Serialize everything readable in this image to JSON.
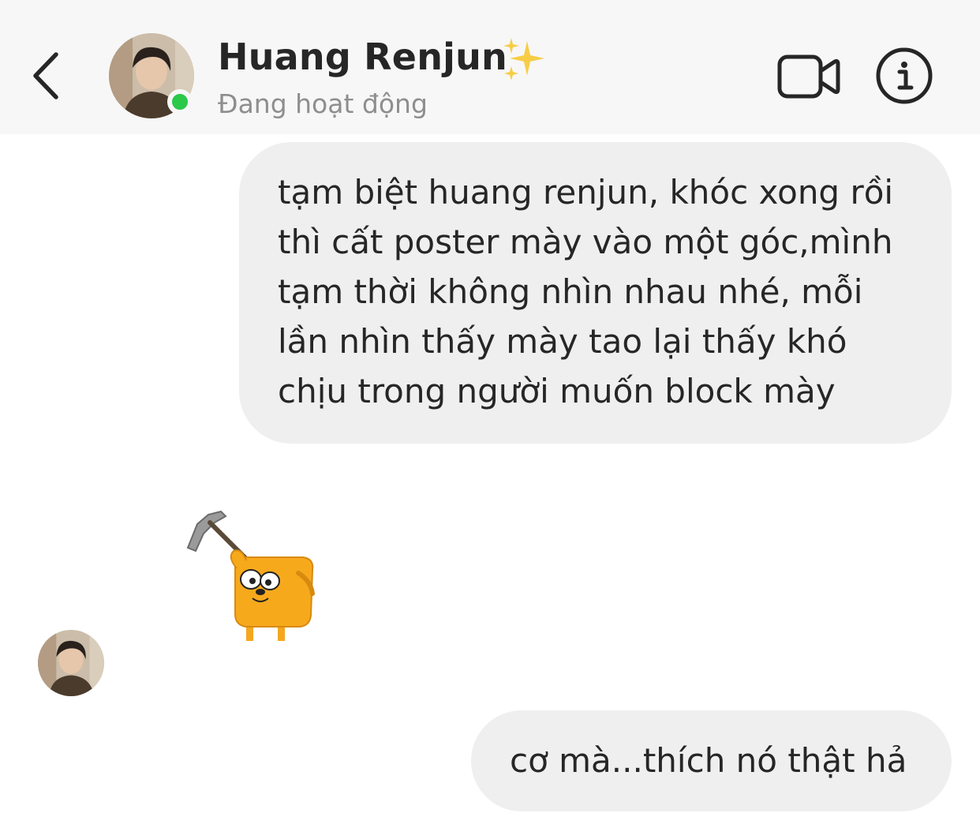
{
  "header": {
    "contact_name": "Huang Renjun",
    "status": "Đang hoạt động",
    "name_badge": "sparkles-emoji",
    "icons": {
      "back": "chevron-left-icon",
      "video_call": "video-camera-icon",
      "info": "info-circle-icon"
    },
    "online_color": "#2bc84a"
  },
  "messages": [
    {
      "sender": "me",
      "type": "text",
      "lines": [
        "tạm biệt huang renjun, khóc xong rồi",
        "thì cất poster mày vào một góc,mình",
        "tạm thời không nhìn nhau nhé, mỗi",
        "lần nhìn thấy mày tao lại thấy khó",
        "chịu trong người muốn block mày"
      ]
    },
    {
      "sender": "them",
      "type": "sticker",
      "sticker": "jake-dog-with-pickaxe-sticker"
    },
    {
      "sender": "me",
      "type": "text",
      "text": "cơ mà...thích nó thật hả"
    }
  ],
  "colors": {
    "header_bg": "#f7f7f7",
    "bubble_bg": "#efefef",
    "text": "#262626",
    "muted_text": "#8e8e8e"
  }
}
